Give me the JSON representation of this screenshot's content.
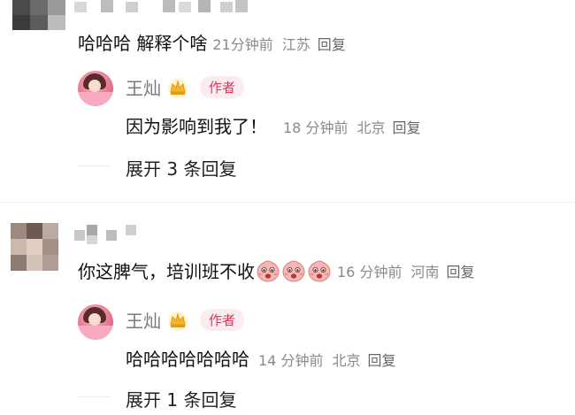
{
  "thread1": {
    "comment_text": "哈哈哈 解释个啥",
    "time": "21分钟前",
    "location": "江苏",
    "reply_label": "回复",
    "reply": {
      "author": "王灿",
      "badge": "作者",
      "text": "因为影响到我了！",
      "time": "18 分钟前",
      "location": "北京",
      "reply_label": "回复"
    },
    "expand_label": "展开 3 条回复"
  },
  "thread2": {
    "comment_text": "你这脾气，培训班不收",
    "emoji_count": 3,
    "time": "16 分钟前",
    "location": "河南",
    "reply_label": "回复",
    "reply": {
      "author": "王灿",
      "badge": "作者",
      "text": "哈哈哈哈哈哈哈",
      "time": "14 分钟前",
      "location": "北京",
      "reply_label": "回复"
    },
    "expand_label": "展开 1 条回复"
  },
  "colors": {
    "badge_text": "#e0345a",
    "badge_bg": "#fdecef",
    "meta_gray": "#8a8a8a"
  },
  "icons": [
    "mosaic-avatar",
    "crown-icon",
    "face-emoji-icon"
  ]
}
